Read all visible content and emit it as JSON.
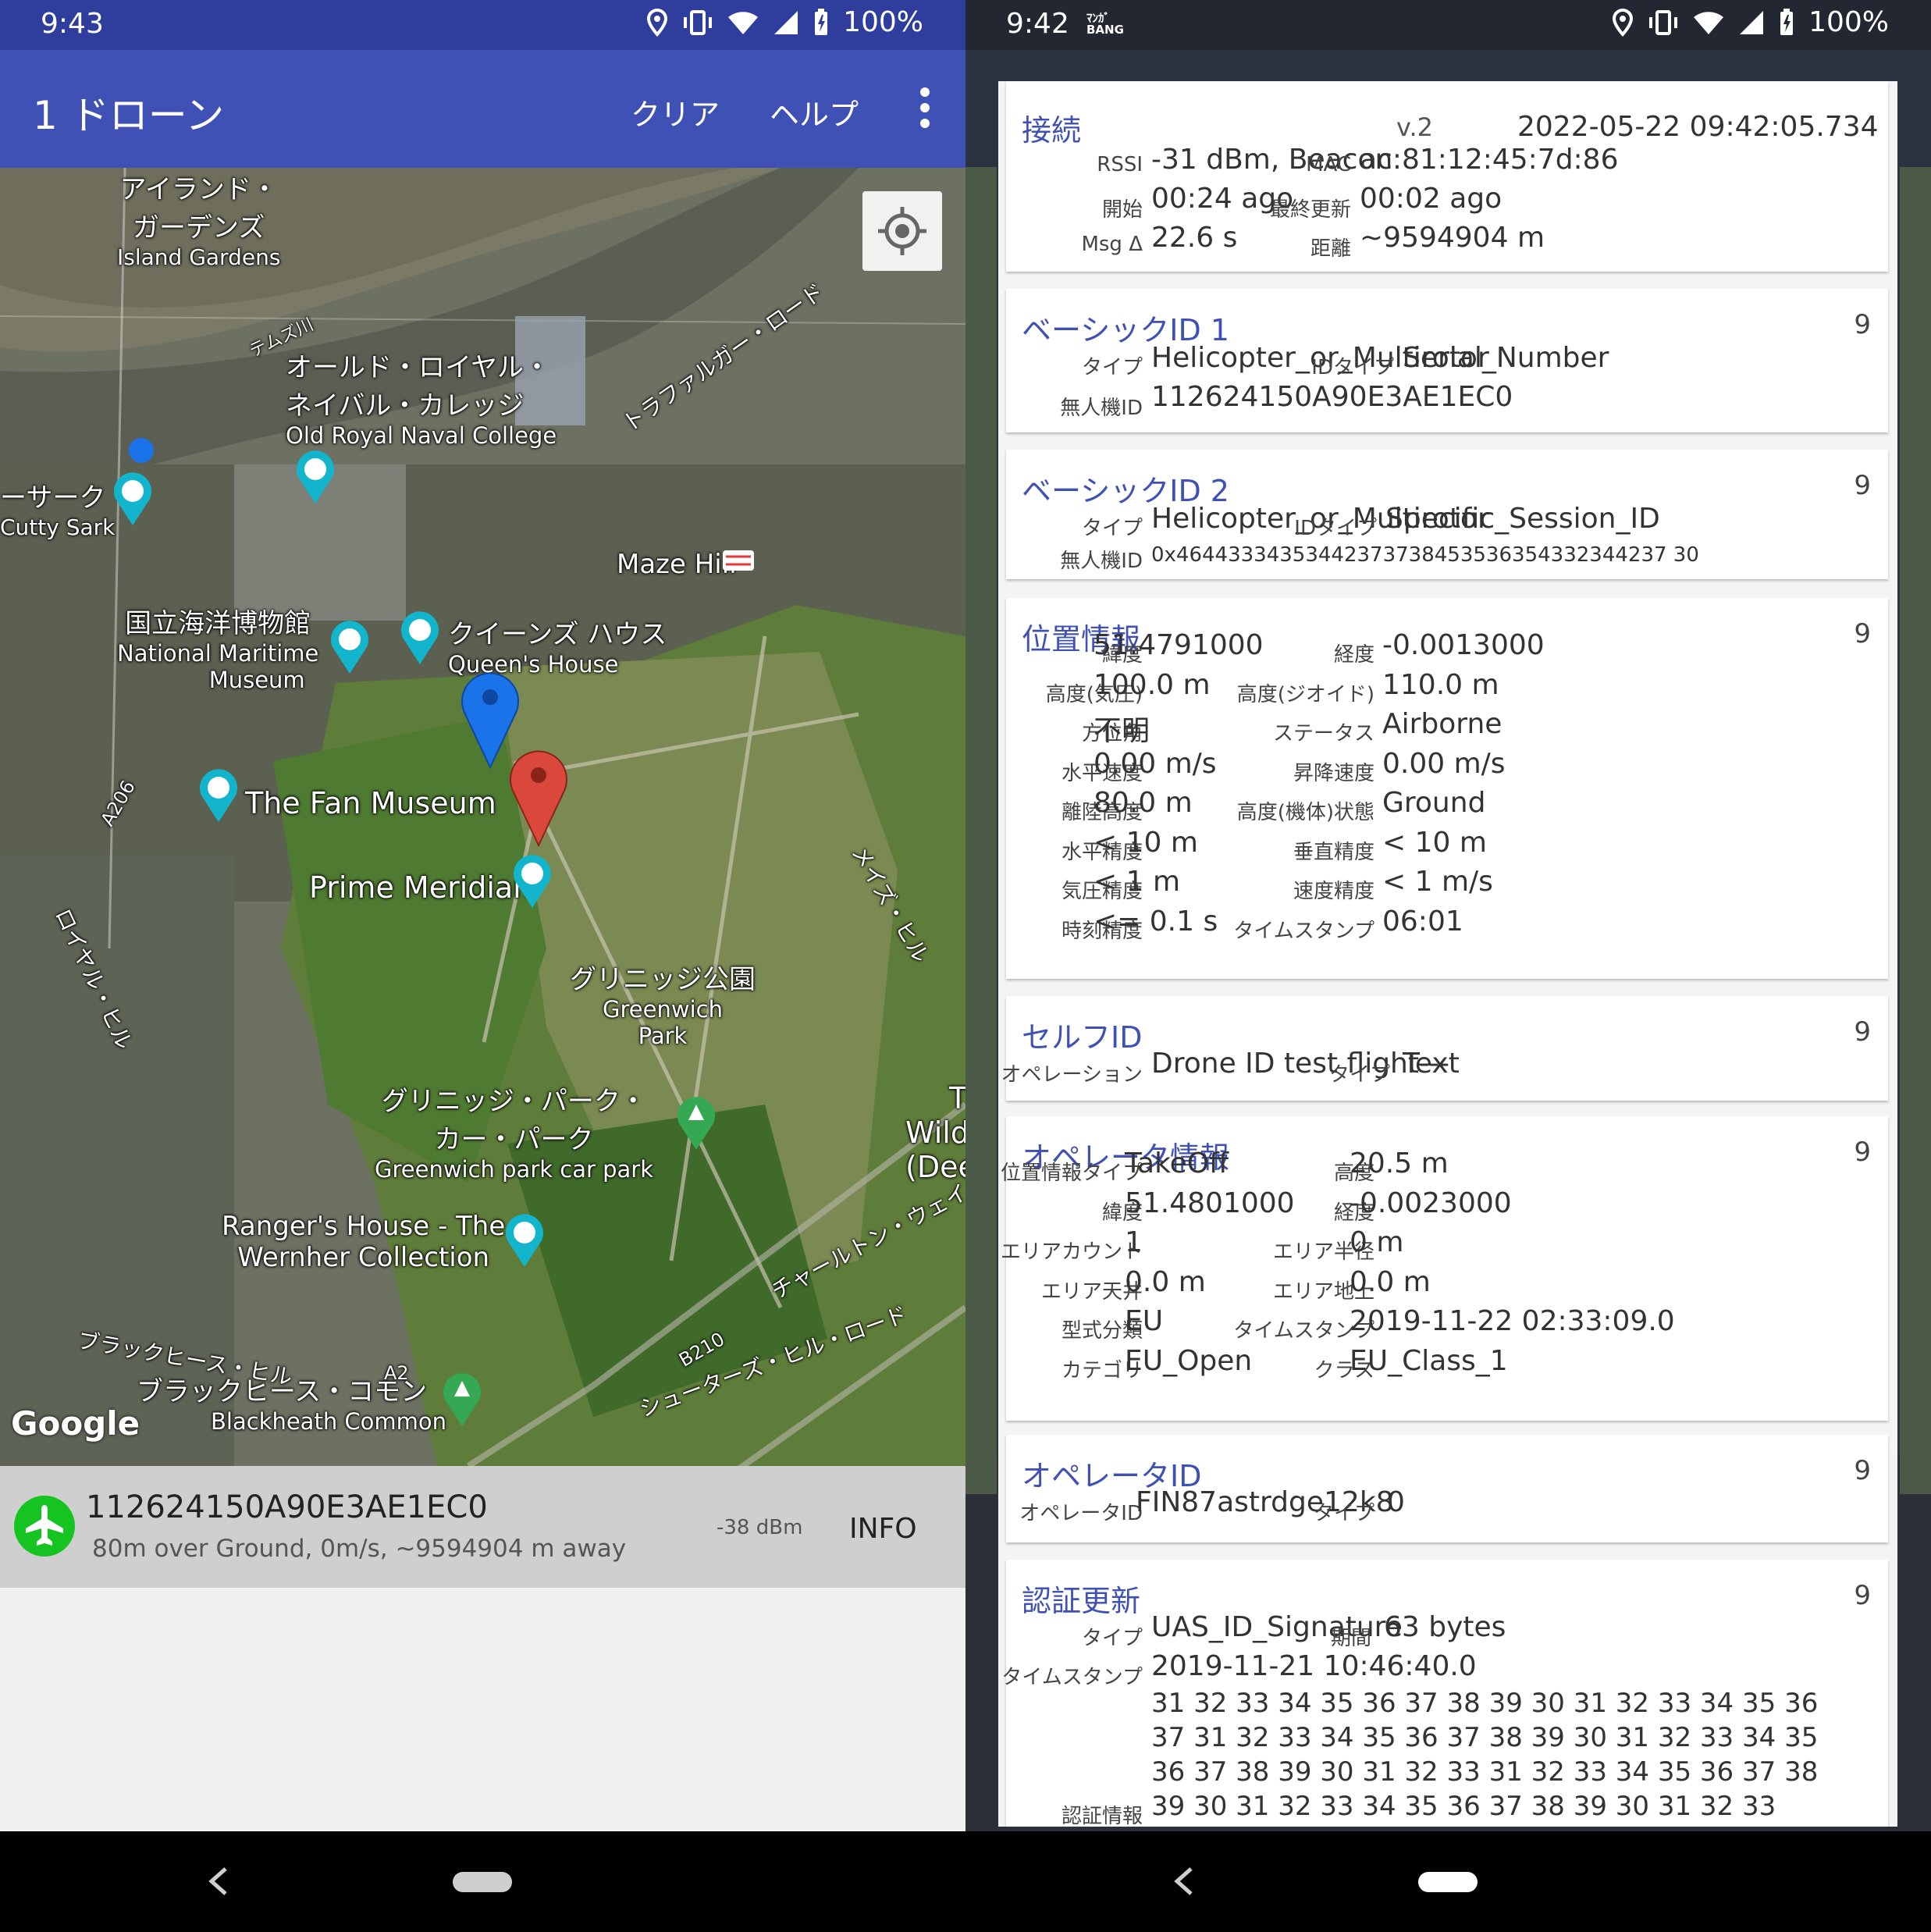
{
  "left": {
    "status": {
      "time": "9:43",
      "battery": "100%"
    },
    "appbar": {
      "title": "1 ドローン",
      "clear": "クリア",
      "help": "ヘルプ"
    },
    "map": {
      "labels": {
        "island_ja": "アイランド・",
        "island_ja2": "ガーデンズ",
        "island_en": "Island Gardens",
        "thames": "テムズ川",
        "orc_ja": "オールド・ロイヤル・",
        "orc_ja2": "ネイバル・カレッジ",
        "orc_en": "Old Royal Naval College",
        "trafalgar": "トラファルガー・ロード",
        "cutty_ja": "ーサーク",
        "cutty_en": "Cutty Sark",
        "maze": "Maze Hill",
        "nmm_ja": "国立海洋博物館",
        "nmm_en": "National Maritime",
        "nmm_en2": "Museum",
        "queens_ja": "クイーンズ ハウス",
        "queens_en": "Queen's House",
        "a206": "A206",
        "fan": "The Fan Museum",
        "royal_hill": "ロイヤル・ヒル",
        "maze_hill_road": "メイズ・ヒル",
        "prime": "Prime Meridian",
        "gpark_ja": "グリニッジ公園",
        "gpark_en": "Greenwich",
        "gpark_en2": "Park",
        "carpark_ja": "グリニッジ・パーク・",
        "carpark_ja2": "カー・パーク",
        "carpark_en": "Greenwich park car park",
        "wilde": "T",
        "wilde2": "Wild",
        "wilde3": "(Dee",
        "ranger": "Ranger's House - The",
        "ranger2": "Wernher Collection",
        "charlton": "チャールトン・ウェイ",
        "bh_hill": "ブラックヒース・ヒル",
        "b210": "B210",
        "shooters": "シューターズ・ヒル・ロード",
        "a2": "A2",
        "bh_common_ja": "ブラックヒース・コモン",
        "bh_common_en": "Blackheath Common",
        "google": "Google"
      }
    },
    "drone": {
      "id": "112624150A90E3AE1EC0",
      "sub": "80m over Ground,   0m/s, ~9594904 m away",
      "rssi": "-38 dBm",
      "info": "INFO"
    }
  },
  "right": {
    "status": {
      "time": "9:42",
      "app_badge_top": "ﾏﾝｶﾞ",
      "app_badge_bottom": "BANG",
      "battery": "100%"
    },
    "connection": {
      "title": "接続",
      "version": "v.2",
      "datetime": "2022-05-22 09:42:05.734",
      "rssi_label": "RSSI",
      "rssi": "-31 dBm, Beacon",
      "mac_label": "MAC",
      "mac": "ac:81:12:45:7d:86",
      "start_label": "開始",
      "start": "00:24  ago",
      "last_label": "最終更新",
      "last": "00:02  ago",
      "msg_label": "Msg Δ",
      "msg": "22.6 s",
      "dist_label": "距離",
      "dist": "~9594904 m"
    },
    "basic1": {
      "title": "ベーシックID 1",
      "num": "9",
      "type_label": "タイプ",
      "type": "Helicopter_or_Multirotor",
      "idtype_label": "IDタイプ",
      "idtype": "Serial_Number",
      "uasid_label": "無人機ID",
      "uasid": "112624150A90E3AE1EC0"
    },
    "basic2": {
      "title": "ベーシックID 2",
      "num": "9",
      "type_label": "タイプ",
      "type": "Helicopter_or_Multirotor",
      "idtype_label": "IDタイプ",
      "idtype": "Specific_Session_ID",
      "uasid_label": "無人機ID",
      "uasid": "0x46443334353442373738453536354332344237 30"
    },
    "location": {
      "title": "位置情報",
      "num": "9",
      "rows": [
        {
          "l1": "緯度",
          "v1": "51.4791000",
          "l2": "経度",
          "v2": "-0.0013000"
        },
        {
          "l1": "高度(気圧)",
          "v1": "100.0 m",
          "l2": "高度(ジオイド)",
          "v2": "110.0 m"
        },
        {
          "l1": "方位角",
          "v1": "不明",
          "l2": "ステータス",
          "v2": "Airborne"
        },
        {
          "l1": "水平速度",
          "v1": "0.00 m/s",
          "l2": "昇降速度",
          "v2": "0.00 m/s"
        },
        {
          "l1": "離陸高度",
          "v1": "80.0 m",
          "l2": "高度(機体)状態",
          "v2": "Ground"
        },
        {
          "l1": "水平精度",
          "v1": "< 10 m",
          "l2": "垂直精度",
          "v2": "< 10 m"
        },
        {
          "l1": "気圧精度",
          "v1": "< 1 m",
          "l2": "速度精度",
          "v2": "< 1 m/s"
        },
        {
          "l1": "時刻精度",
          "v1": "<= 0.1 s",
          "l2": "タイムスタンプ",
          "v2": "06:01"
        }
      ]
    },
    "selfid": {
      "title": "セルフID",
      "num": "9",
      "op_label": "オペレーション",
      "op": "Drone ID test flight---",
      "type_label": "タイプ",
      "type": "Text"
    },
    "operator": {
      "title": "オペレータ情報",
      "num": "9",
      "rows": [
        {
          "l1": "位置情報タイプ",
          "v1": "TakeOff",
          "l2": "高度",
          "v2": "20.5 m"
        },
        {
          "l1": "緯度",
          "v1": "51.4801000",
          "l2": "経度",
          "v2": "-0.0023000"
        },
        {
          "l1": "エリアカウント",
          "v1": "1",
          "l2": "エリア半径",
          "v2": "0 m"
        },
        {
          "l1": "エリア天井",
          "v1": "0.0 m",
          "l2": "エリア地上",
          "v2": "0.0 m"
        },
        {
          "l1": "型式分類",
          "v1": "EU",
          "l2": "タイムスタンプ",
          "v2": "2019-11-22 02:33:09.0"
        },
        {
          "l1": "カテゴリ",
          "v1": "EU_Open",
          "l2": "クラス",
          "v2": "EU_Class_1"
        }
      ]
    },
    "operatorid": {
      "title": "オペレータID",
      "num": "9",
      "id_label": "オペレータID",
      "id": "FIN87astrdge12k8",
      "type_label": "タイプ",
      "type": "0"
    },
    "auth": {
      "title": "認証更新",
      "num": "9",
      "type_label": "タイプ",
      "type": "UAS_ID_Signature",
      "len_label": "期間",
      "len": "63 bytes",
      "ts_label": "タイムスタンプ",
      "ts": "2019-11-21 10:46:40.0",
      "data_label": "認証情報",
      "lines": [
        "31 32 33 34 35 36 37 38 39 30 31 32 33 34 35 36",
        "37 31 32 33 34 35 36 37 38 39 30 31 32 33 34 35",
        "36 37 38 39 30 31 32 33 31 32 33 34 35 36 37 38",
        "39 30 31 32 33 34 35 36 37 38 39 30 31 32 33"
      ]
    }
  }
}
